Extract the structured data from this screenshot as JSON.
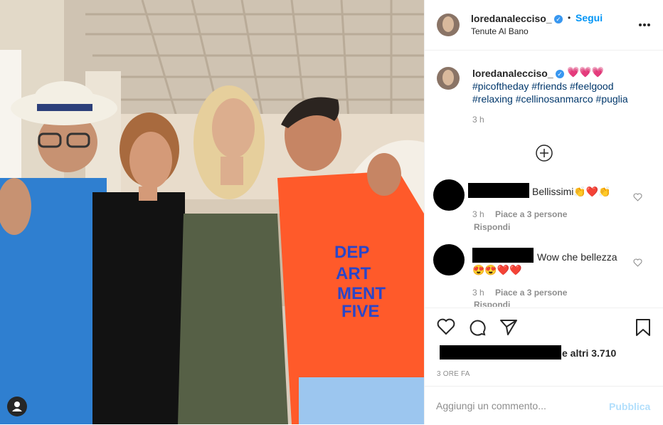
{
  "header": {
    "username": "loredanalecciso_",
    "follow_label": "Segui",
    "separator": "•",
    "location": "Tenute Al Bano"
  },
  "caption": {
    "username": "loredanalecciso_",
    "hearts": "💗💗💗",
    "line1": "#picoftheday #friends #feelgood",
    "line2": "#relaxing #cellinosanmarco #puglia",
    "time": "3 h"
  },
  "comments": [
    {
      "text": "Bellissimi👏❤️👏",
      "time": "3 h",
      "likes": "Piace a 3 persone",
      "reply": "Rispondi"
    },
    {
      "text_line1": "Wow che bellezza",
      "text_line2": "😍😍❤️❤️",
      "time": "3 h",
      "likes": "Piace a 3 persone",
      "reply": "Rispondi"
    }
  ],
  "likes_line": {
    "suffix": "e altri 3.710"
  },
  "post_time": "3 ORE FA",
  "comment_box": {
    "placeholder": "Aggiungi un commento...",
    "publish": "Pubblica"
  },
  "photo_shirt_text": [
    "DEP",
    "ART",
    "MENT",
    "FIVE"
  ],
  "colors": {
    "accent": "#0095f6",
    "hashtag": "#00376b",
    "muted": "#8e8e8e",
    "shirt": "#ff5a2a"
  },
  "icons": [
    "more-icon",
    "add-comment-icon",
    "heart-icon",
    "comment-icon",
    "share-icon",
    "bookmark-icon",
    "user-tag-icon"
  ]
}
